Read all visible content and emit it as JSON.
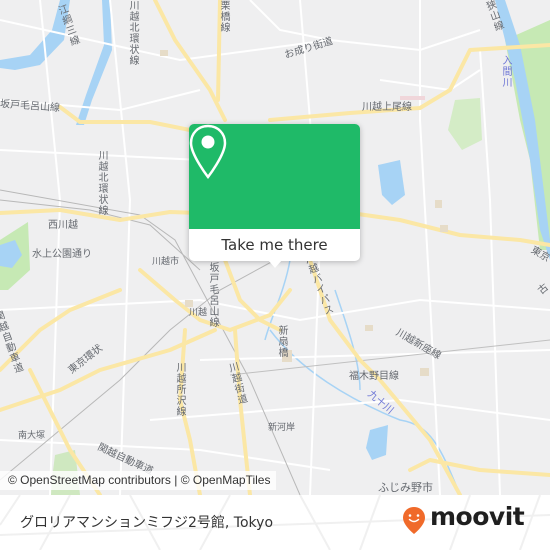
{
  "map": {
    "colors": {
      "background": "#efeff0",
      "road_major": "#fbe7a5",
      "road_minor": "#ffffff",
      "water": "#a7d3f5",
      "park": "#c6e9b4",
      "accent": "#1fba68"
    },
    "labels": [
      {
        "id": "road-r254",
        "text": "川越北環状線",
        "kind": "road"
      },
      {
        "id": "road-kawagoe-ring",
        "text": "川越北環状線",
        "kind": "road"
      },
      {
        "id": "road-kuribashi",
        "text": "栗橋線",
        "kind": "road"
      },
      {
        "id": "road-sakado-moroyama-w",
        "text": "坂戸毛呂山線",
        "kind": "road"
      },
      {
        "id": "road-onari",
        "text": "お成り街道",
        "kind": "road"
      },
      {
        "id": "road-kawagoe-ageo",
        "text": "川越上尾線",
        "kind": "road"
      },
      {
        "id": "road-kodai",
        "text": "江綱三線",
        "kind": "road"
      },
      {
        "id": "road-sayama",
        "text": "狭山線",
        "kind": "road"
      },
      {
        "id": "river-iruma",
        "text": "入間川",
        "kind": "river"
      },
      {
        "id": "road-kawagoe-kitakanjo",
        "text": "川越北環状線",
        "kind": "road"
      },
      {
        "id": "place-nishikawagoe",
        "text": "西川越",
        "kind": "place"
      },
      {
        "id": "road-mizukami",
        "text": "水上公園通り",
        "kind": "road"
      },
      {
        "id": "place-kawagoeshi",
        "text": "川越市",
        "kind": "place"
      },
      {
        "id": "place-kawagoe",
        "text": "川越",
        "kind": "place"
      },
      {
        "id": "road-sakado-moroyama",
        "text": "坂戸毛呂山線",
        "kind": "road"
      },
      {
        "id": "road-bypass",
        "text": "川越バイパス",
        "kind": "road"
      },
      {
        "id": "road-kanetsu",
        "text": "関越自動車道",
        "kind": "road"
      },
      {
        "id": "road-tokyo-kanjo",
        "text": "東京環状",
        "kind": "road"
      },
      {
        "id": "road-kawagoe-tokorozawa",
        "text": "川越所沢線",
        "kind": "road"
      },
      {
        "id": "road-kawagoe-kaido",
        "text": "川越街道",
        "kind": "road"
      },
      {
        "id": "place-shinogashi",
        "text": "新扇橋",
        "kind": "place"
      },
      {
        "id": "road-kawagoe-shinza",
        "text": "川越新座線",
        "kind": "road"
      },
      {
        "id": "road-fukuokanome",
        "text": "福木野目線",
        "kind": "road"
      },
      {
        "id": "river-kujukawa",
        "text": "九十川",
        "kind": "river"
      },
      {
        "id": "place-shingashi",
        "text": "新河岸",
        "kind": "place"
      },
      {
        "id": "place-minamiotsuka",
        "text": "南大塚",
        "kind": "place"
      },
      {
        "id": "road-tokyo-east",
        "text": "東京",
        "kind": "road"
      },
      {
        "id": "road-kanetsu-w",
        "text": "関越自動車道",
        "kind": "road"
      },
      {
        "id": "place-fujimino",
        "text": "ふじみ野市",
        "kind": "place"
      },
      {
        "id": "road-hasuda",
        "text": "川",
        "kind": "road"
      },
      {
        "id": "road-east-edge",
        "text": "古",
        "kind": "road"
      }
    ],
    "attribution": "© OpenStreetMap contributors | © OpenMapTiles"
  },
  "popup": {
    "icon": "map-pin-icon",
    "button_label": "Take me there"
  },
  "footer": {
    "place_name": "グロリアマンションミフジ2号館, Tokyo",
    "brand": {
      "name": "moovit",
      "icon": "moovit-pin-logo",
      "color": "#f06a2a"
    }
  }
}
